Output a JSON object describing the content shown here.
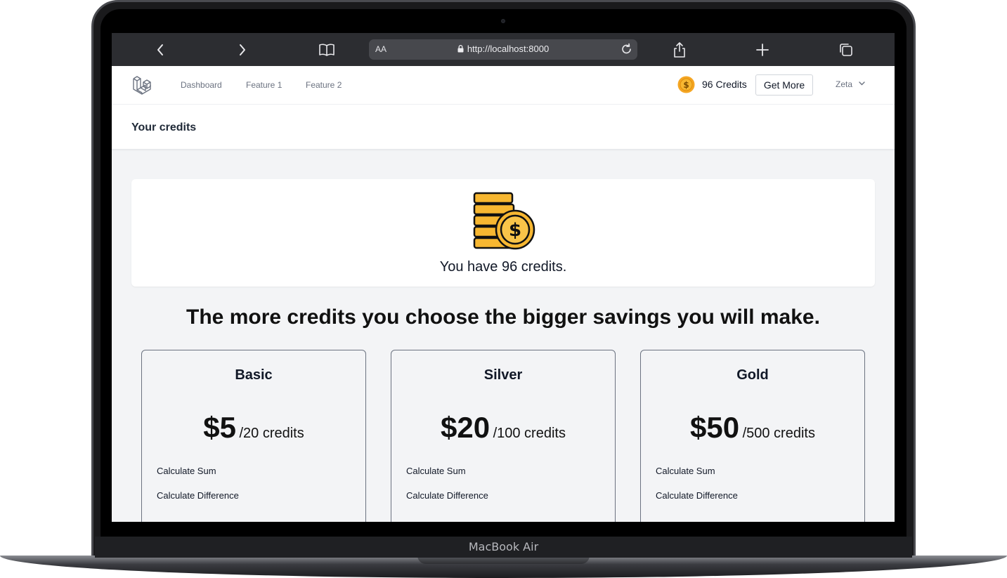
{
  "device": {
    "label": "MacBook Air"
  },
  "browser": {
    "reader_label": "AA",
    "url": "http://localhost:8000"
  },
  "nav": {
    "links": [
      "Dashboard",
      "Feature 1",
      "Feature 2"
    ],
    "credits_label": "96 Credits",
    "get_more_label": "Get More",
    "user_name": "Zeta"
  },
  "header": {
    "title": "Your credits"
  },
  "credit_summary": {
    "text": "You have 96 credits."
  },
  "tagline": "The more credits you choose the bigger savings you will make.",
  "plans": [
    {
      "name": "Basic",
      "price": "$5",
      "per": "/20 credits",
      "features": [
        "Calculate Sum",
        "Calculate Difference"
      ]
    },
    {
      "name": "Silver",
      "price": "$20",
      "per": "/100 credits",
      "features": [
        "Calculate Sum",
        "Calculate Difference"
      ]
    },
    {
      "name": "Gold",
      "price": "$50",
      "per": "/500 credits",
      "features": [
        "Calculate Sum",
        "Calculate Difference"
      ]
    }
  ],
  "colors": {
    "coin_gold": "#f7b731",
    "coin_outline": "#111111",
    "toolbar_bg": "#2c2d31",
    "page_bg": "#f3f4f6"
  }
}
